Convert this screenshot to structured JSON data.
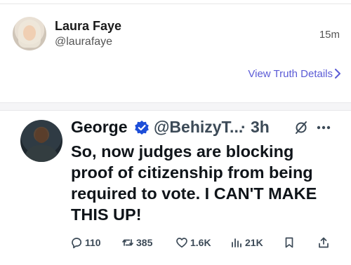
{
  "truth": {
    "author_name": "Laura Faye",
    "author_handle": "@laurafaye",
    "time": "15m",
    "details_link": "View Truth Details"
  },
  "tweet": {
    "name": "George",
    "handle": "@BehizyT...",
    "separator": "·",
    "time": "3h",
    "text": "So, now judges are blocking proof of citizenship from being required to vote. I CAN'T MAKE THIS UP!",
    "actions": {
      "replies": "110",
      "reposts": "385",
      "likes": "1.6K",
      "views": "21K"
    }
  },
  "colors": {
    "link": "#5b5bd6",
    "verified": "#1d4ed8",
    "text": "#0f1419",
    "muted": "#3c4a57"
  },
  "icons": [
    "chevron-right-icon",
    "verified-badge-icon",
    "grok-icon",
    "more-icon",
    "reply-icon",
    "repost-icon",
    "like-icon",
    "views-icon",
    "bookmark-icon",
    "share-icon"
  ]
}
